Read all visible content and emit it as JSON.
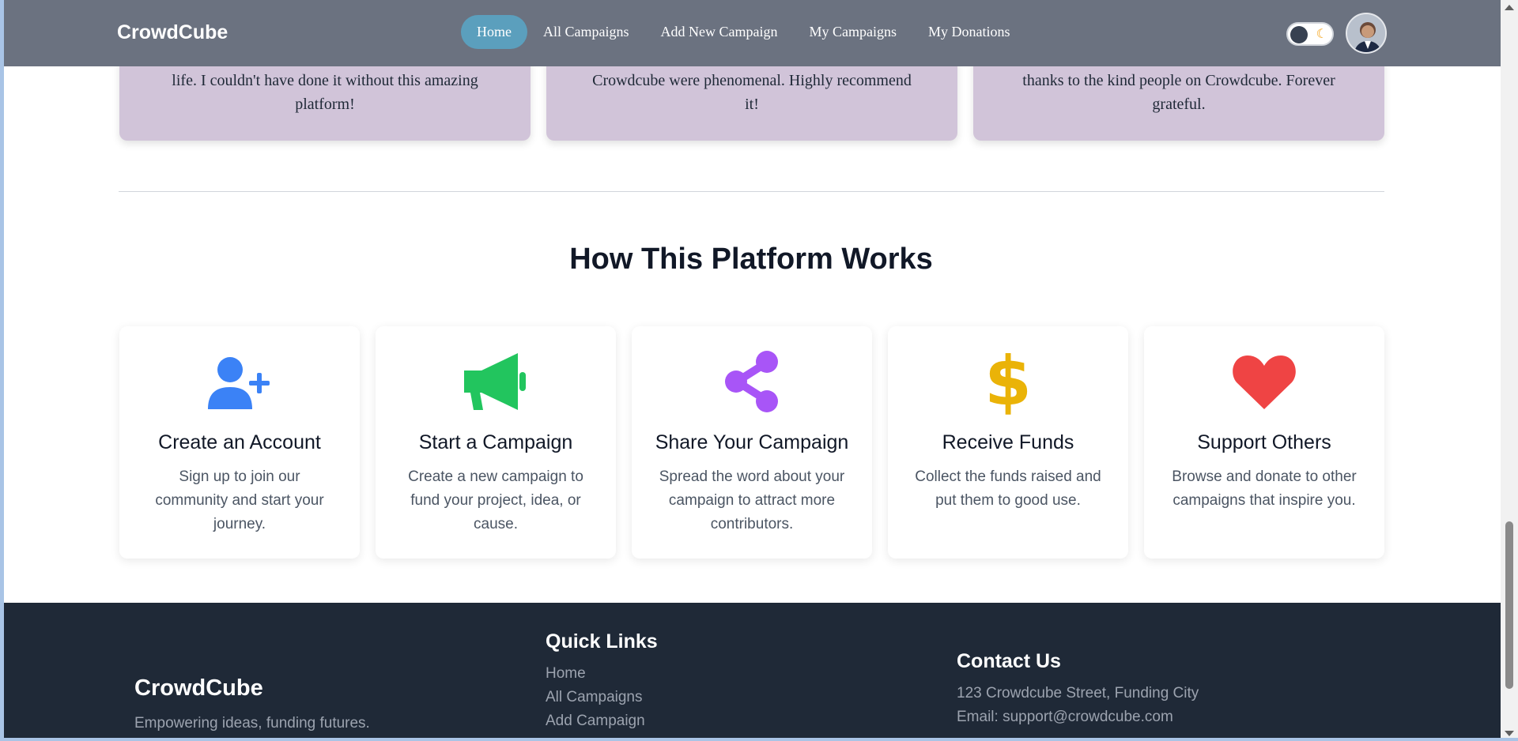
{
  "navbar": {
    "brand": "CrowdCube",
    "links": [
      "Home",
      "All Campaigns",
      "Add New Campaign",
      "My Campaigns",
      "My Donations"
    ],
    "active_link": "Home",
    "toggle_icon": "moon-icon"
  },
  "testimonials": [
    {
      "text_lines": [
        "life. I couldn't have done it without this amazing",
        "platform!"
      ]
    },
    {
      "text_lines": [
        "Crowdcube were phenomenal. Highly recommend",
        "it!"
      ]
    },
    {
      "text_lines": [
        "thanks to the kind people on Crowdcube. Forever",
        "grateful."
      ]
    }
  ],
  "how_it_works": {
    "title": "How This Platform Works",
    "steps": [
      {
        "icon": "user-plus-icon",
        "color": "#3b82f6",
        "title": "Create an Account",
        "desc": "Sign up to join our community and start your journey."
      },
      {
        "icon": "megaphone-icon",
        "color": "#22c55e",
        "title": "Start a Campaign",
        "desc": "Create a new campaign to fund your project, idea, or cause."
      },
      {
        "icon": "share-icon",
        "color": "#a855f7",
        "title": "Share Your Campaign",
        "desc": "Spread the word about your campaign to attract more contributors."
      },
      {
        "icon": "dollar-icon",
        "color": "#eab308",
        "title": "Receive Funds",
        "desc": "Collect the funds raised and put them to good use."
      },
      {
        "icon": "heart-icon",
        "color": "#ef4444",
        "title": "Support Others",
        "desc": "Browse and donate to other campaigns that inspire you."
      }
    ]
  },
  "footer": {
    "brand": "CrowdCube",
    "tagline": "Empowering ideas, funding futures.",
    "quick_links_title": "Quick Links",
    "quick_links": [
      "Home",
      "All Campaigns",
      "Add Campaign"
    ],
    "contact_title": "Contact Us",
    "address": "123 Crowdcube Street, Funding City",
    "email": "Email: support@crowdcube.com"
  }
}
